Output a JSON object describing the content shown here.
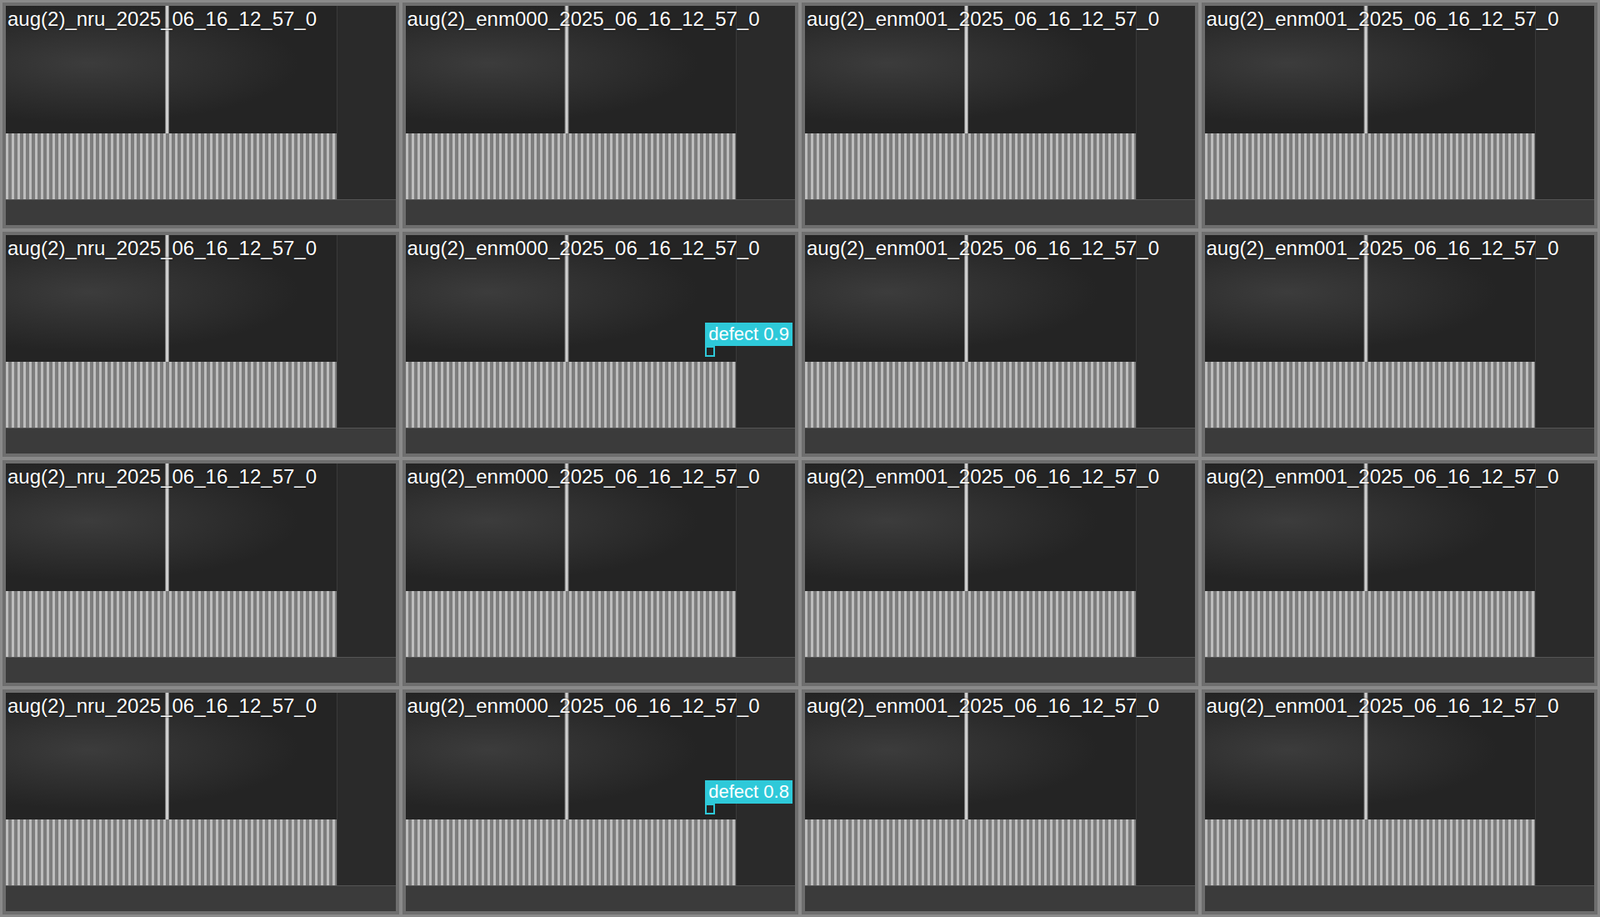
{
  "grid": {
    "columns": 4,
    "tiles": [
      {
        "label": "aug(2)_nru_2025_06_16_12_57_0",
        "detections": []
      },
      {
        "label": "aug(2)_enm000_2025_06_16_12_57_0",
        "detections": []
      },
      {
        "label": "aug(2)_enm001_2025_06_16_12_57_0",
        "detections": []
      },
      {
        "label": "aug(2)_enm001_2025_06_16_12_57_0",
        "detections": []
      },
      {
        "label": "aug(2)_nru_2025_06_16_12_57_0",
        "detections": []
      },
      {
        "label": "aug(2)_enm000_2025_06_16_12_57_0",
        "detections": [
          {
            "label": "defect 0.9",
            "box": [
              0.765,
              0.51,
              0.025,
              0.045
            ]
          }
        ]
      },
      {
        "label": "aug(2)_enm001_2025_06_16_12_57_0",
        "detections": []
      },
      {
        "label": "aug(2)_enm001_2025_06_16_12_57_0",
        "detections": []
      },
      {
        "label": "aug(2)_nru_2025_06_16_12_57_0",
        "detections": []
      },
      {
        "label": "aug(2)_enm000_2025_06_16_12_57_0",
        "detections": []
      },
      {
        "label": "aug(2)_enm001_2025_06_16_12_57_0",
        "detections": []
      },
      {
        "label": "aug(2)_enm001_2025_06_16_12_57_0",
        "detections": []
      },
      {
        "label": "aug(2)_nru_2025_06_16_12_57_0",
        "detections": []
      },
      {
        "label": "aug(2)_enm000_2025_06_16_12_57_0",
        "detections": [
          {
            "label": "defect 0.8",
            "box": [
              0.765,
              0.51,
              0.025,
              0.045
            ]
          }
        ]
      },
      {
        "label": "aug(2)_enm001_2025_06_16_12_57_0",
        "detections": []
      },
      {
        "label": "aug(2)_enm001_2025_06_16_12_57_0",
        "detections": []
      }
    ]
  }
}
